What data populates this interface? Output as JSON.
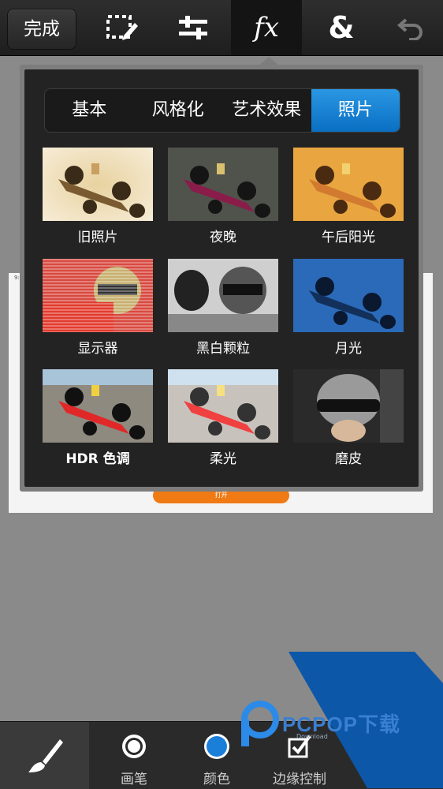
{
  "toolbar": {
    "done_label": "完成",
    "tools": [
      {
        "name": "selection-icon"
      },
      {
        "name": "adjust-sliders-icon"
      },
      {
        "name": "fx-icon",
        "label": "fx"
      },
      {
        "name": "ampersand-icon",
        "label": "&"
      },
      {
        "name": "undo-icon"
      }
    ]
  },
  "effects_panel": {
    "tabs": [
      "基本",
      "风格化",
      "艺术效果",
      "照片"
    ],
    "active_tab": "照片",
    "effects": [
      "旧照片",
      "夜晚",
      "午后阳光",
      "显示器",
      "黑白颗粒",
      "月光",
      "HDR 色调",
      "柔光",
      "磨皮"
    ]
  },
  "background": {
    "open_button": "打开"
  },
  "bottom": {
    "tools": [
      {
        "name": "brush-icon"
      },
      {
        "label": "画笔"
      },
      {
        "label": "颜色"
      },
      {
        "label": "边缘控制"
      }
    ]
  },
  "watermark": {
    "text": "PCPOP下载",
    "sub": "Download"
  },
  "colors": {
    "accent": "#1a84d6",
    "toolbar": "#262626",
    "panel": "#232323",
    "orange": "#f07a14"
  }
}
